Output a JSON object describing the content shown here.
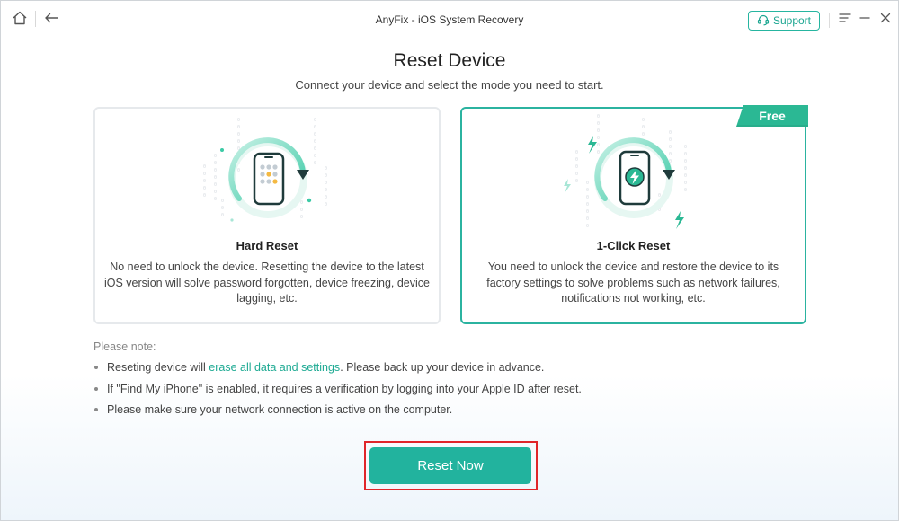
{
  "titlebar": {
    "app_title": "AnyFix - iOS System Recovery",
    "support_label": "Support",
    "icons": [
      "home-icon",
      "back-arrow-icon",
      "headset-icon",
      "menu-icon",
      "minimize-icon",
      "close-icon"
    ]
  },
  "page": {
    "title": "Reset Device",
    "subtitle": "Connect your device and select the mode you need to start."
  },
  "modes": [
    {
      "title": "Hard Reset",
      "description": "No need to unlock the device. Resetting the device to the latest iOS version will solve password forgotten, device freezing, device lagging, etc.",
      "selected": false
    },
    {
      "title": "1-Click Reset",
      "badge": "Free",
      "description": "You need to unlock the device and restore the device to its factory settings to solve problems such as network failures, notifications not working, etc.",
      "selected": true
    }
  ],
  "notes": {
    "heading": "Please note:",
    "item1": {
      "before": "Reseting device will ",
      "highlight": "erase all data and settings",
      "after": ". Please back up your device in advance."
    },
    "item2": "If \"Find My iPhone\" is enabled, it requires a verification by logging into your Apple ID after reset.",
    "item3": "Please make sure your network connection is active on the computer."
  },
  "cta": {
    "label": "Reset Now"
  },
  "colors": {
    "accent": "#22b39e",
    "free_badge": "#2bb894",
    "highlight_border": "#e0262a"
  }
}
